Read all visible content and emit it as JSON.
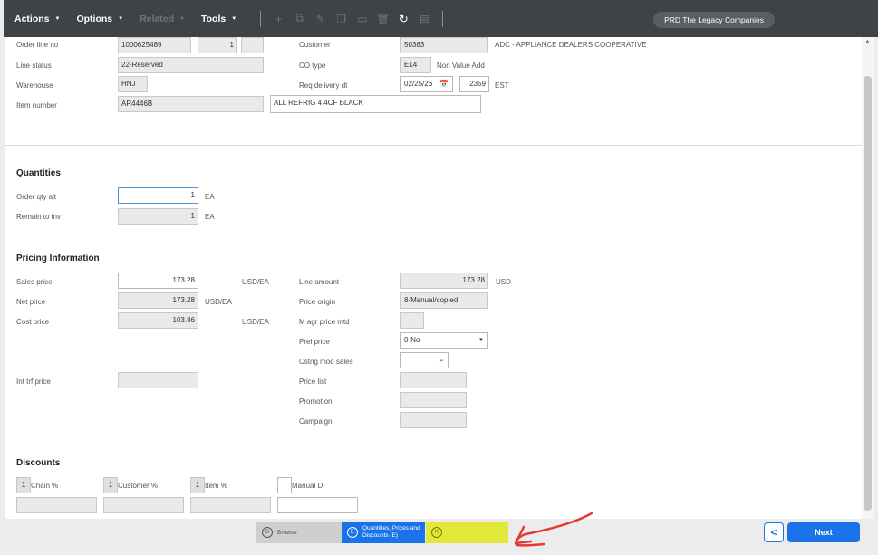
{
  "toolbar": {
    "actions": "Actions",
    "options": "Options",
    "related": "Related",
    "tools": "Tools",
    "company": "PRD The Legacy Companies"
  },
  "header": {
    "order_line_no_label": "Order line no",
    "order_no": "1000625489",
    "line_no": "1",
    "line_sub": "",
    "customer_label": "Customer",
    "customer": "50383",
    "customer_name": "ADC - APPLIANCE DEALERS COOPERATIVE",
    "line_status_label": "Line status",
    "line_status": "22-Reserved",
    "co_type_label": "CO type",
    "co_type": "E14",
    "co_type_desc": "Non Value Add",
    "warehouse_label": "Warehouse",
    "warehouse": "HNJ",
    "req_delivery_label": "Req delivery dt",
    "req_delivery": "02/25/26",
    "req_time": "2359",
    "tz": "EST",
    "item_number_label": "Item number",
    "item_number": "AR4446B",
    "item_desc": "ALL REFRIG 4.4CF BLACK"
  },
  "quantities": {
    "title": "Quantities",
    "order_qty_label": "Order qty alt",
    "order_qty": "1",
    "order_qty_unit": "EA",
    "remain_label": "Remain to inv",
    "remain": "1",
    "remain_unit": "EA"
  },
  "pricing": {
    "title": "Pricing Information",
    "sales_price_label": "Sales price",
    "sales_price": "173.28",
    "sales_unit": "USD/EA",
    "net_price_label": "Net price",
    "net_price": "173.28",
    "net_unit": "USD/EA",
    "cost_price_label": "Cost price",
    "cost_price": "103.86",
    "cost_unit": "USD/EA",
    "int_trf_label": "Int trf price",
    "int_trf": "",
    "line_amount_label": "Line amount",
    "line_amount": "173.28",
    "line_amount_unit": "USD",
    "price_origin_label": "Price origin",
    "price_origin": "8-Manual/copied",
    "m_agr_label": "M agr price mtd",
    "m_agr": "",
    "prel_price_label": "Prel price",
    "prel_price": "0-No",
    "cstng_label": "Cstng mod sales",
    "cstng": "",
    "price_list_label": "Price list",
    "price_list": "",
    "promotion_label": "Promotion",
    "promotion": "",
    "campaign_label": "Campaign",
    "campaign": ""
  },
  "discounts": {
    "title": "Discounts",
    "chain_label": "Chain %",
    "chain": "1",
    "customer_label": "Customer %",
    "customer": "1",
    "item_label": "Item %",
    "item": "1",
    "manual_label": "Manual D"
  },
  "footer": {
    "browse_key": "B",
    "browse": "Browse",
    "qty_key": "E",
    "qty_line1": "Quantities, Prices and",
    "qty_line2": "Discounts (E)",
    "k_key": "K",
    "back": "<",
    "next": "Next"
  },
  "colors": {
    "toolbar_bg": "#3f4346",
    "accent": "#1a73e8",
    "highlight": "#e1e83a",
    "annotation_arrow": "#e53935"
  }
}
